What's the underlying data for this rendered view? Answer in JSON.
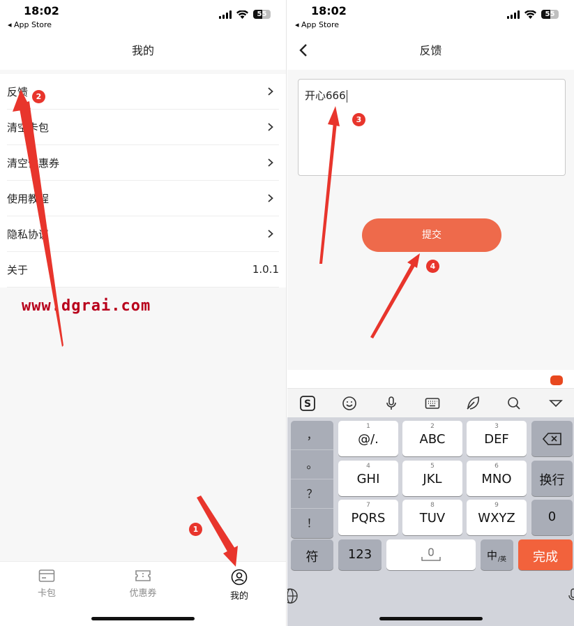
{
  "colors": {
    "accent": "#ee6a4b",
    "done_key": "#f2623c",
    "watermark": "#b8001b",
    "annotation": "#e8352c"
  },
  "left_screen": {
    "status": {
      "time": "18:02",
      "back_label": "◂ App Store",
      "battery": "55"
    },
    "nav_title": "我的",
    "menu": [
      {
        "label": "反馈",
        "icon": "chevron-right-icon"
      },
      {
        "label": "清空卡包",
        "icon": "chevron-right-icon"
      },
      {
        "label": "清空优惠券",
        "icon": "chevron-right-icon"
      },
      {
        "label": "使用教程",
        "icon": "chevron-right-icon"
      },
      {
        "label": "隐私协议",
        "icon": "chevron-right-icon"
      },
      {
        "label": "关于",
        "value": "1.0.1"
      }
    ],
    "watermark": "www.dgrai.com",
    "tabs": [
      {
        "label": "卡包",
        "icon": "card-icon",
        "active": false
      },
      {
        "label": "优惠券",
        "icon": "coupon-icon",
        "active": false
      },
      {
        "label": "我的",
        "icon": "profile-icon",
        "active": true
      }
    ]
  },
  "right_screen": {
    "status": {
      "time": "18:02",
      "back_label": "◂ App Store",
      "battery": "55"
    },
    "nav_title": "反馈",
    "feedback_text": "开心666",
    "submit_label": "提交",
    "keyboard": {
      "toolbar_icons": [
        "sogou-logo-icon",
        "emoji-icon",
        "microphone-icon",
        "keyboard-icon",
        "quill-icon",
        "search-icon",
        "collapse-icon"
      ],
      "punctuation": [
        "，",
        "。",
        "？",
        "！"
      ],
      "keys": [
        {
          "digit": "1",
          "label": "@/."
        },
        {
          "digit": "2",
          "label": "ABC"
        },
        {
          "digit": "3",
          "label": "DEF"
        },
        {
          "digit": "4",
          "label": "GHI"
        },
        {
          "digit": "5",
          "label": "JKL"
        },
        {
          "digit": "6",
          "label": "MNO"
        },
        {
          "digit": "7",
          "label": "PQRS"
        },
        {
          "digit": "8",
          "label": "TUV"
        },
        {
          "digit": "9",
          "label": "WXYZ"
        }
      ],
      "right_keys": {
        "newline": "换行",
        "zero": "0"
      },
      "bottom": {
        "symbol": "符",
        "numbers": "123",
        "lang_main": "中",
        "lang_sub": "/英",
        "done": "完成"
      }
    }
  },
  "annotations": [
    "1",
    "2",
    "3",
    "4"
  ]
}
